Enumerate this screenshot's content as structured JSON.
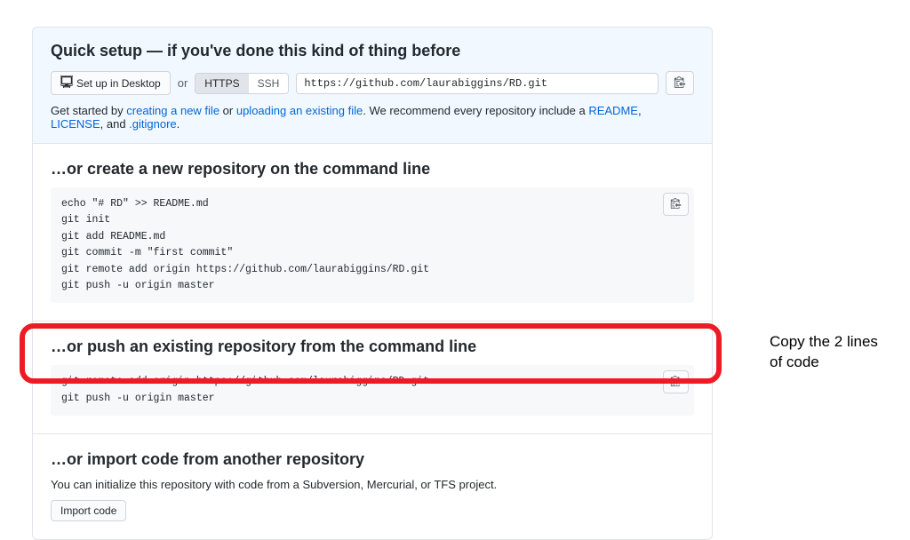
{
  "quick_setup": {
    "heading": "Quick setup — if you've done this kind of thing before",
    "desktop_btn": "Set up in Desktop",
    "or": "or",
    "https_label": "HTTPS",
    "ssh_label": "SSH",
    "repo_url": "https://github.com/laurabiggins/RD.git",
    "hint_prefix": "Get started by ",
    "link_create": "creating a new file",
    "hint_or": " or ",
    "link_upload": "uploading an existing file",
    "hint_mid": ". We recommend every repository include a ",
    "link_readme": "README",
    "comma1": ", ",
    "link_license": "LICENSE",
    "comma2": ", and ",
    "link_gitignore": ".gitignore",
    "period": "."
  },
  "create_section": {
    "heading": "…or create a new repository on the command line",
    "code": "echo \"# RD\" >> README.md\ngit init\ngit add README.md\ngit commit -m \"first commit\"\ngit remote add origin https://github.com/laurabiggins/RD.git\ngit push -u origin master"
  },
  "push_section": {
    "heading": "…or push an existing repository from the command line",
    "code": "git remote add origin https://github.com/laurabiggins/RD.git\ngit push -u origin master"
  },
  "import_section": {
    "heading": "…or import code from another repository",
    "desc": "You can initialize this repository with code from a Subversion, Mercurial, or TFS project.",
    "btn": "Import code"
  },
  "annotation": {
    "text": "Copy the 2 lines of code"
  }
}
